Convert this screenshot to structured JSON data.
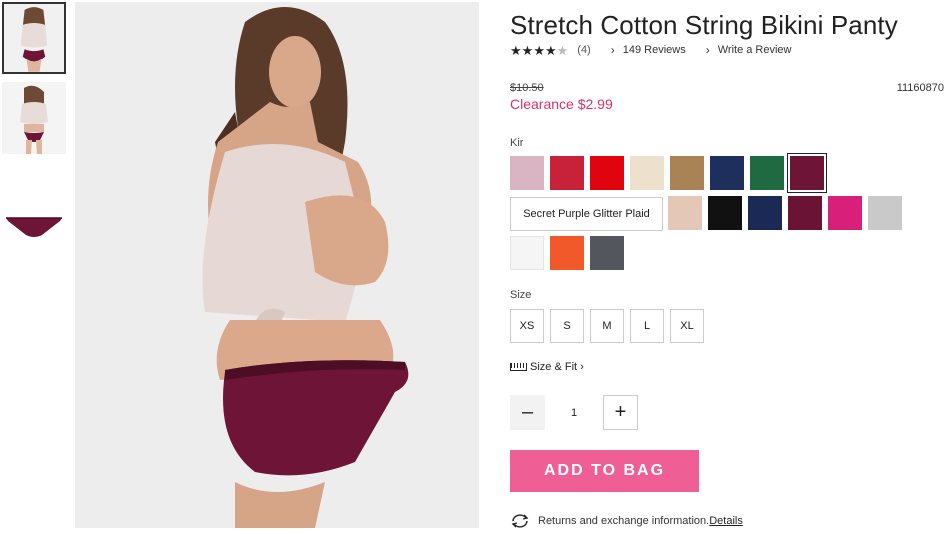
{
  "product": {
    "title": "Stretch Cotton String Bikini Panty",
    "rating_stars": 4,
    "rating_count": "(4)",
    "reviews_link": "149 Reviews",
    "write_review_link": "Write a Review",
    "old_price": "$10.50",
    "clearance_price": "Clearance $2.99",
    "item_number": "11160870"
  },
  "color": {
    "label": "Kir",
    "selected_name": "Secret Purple Glitter Plaid",
    "swatch_colors": [
      "#d9b4c3",
      "#c8213a",
      "#e0040e",
      "#ede0cc",
      "#a98255",
      "#1e2f5e",
      "#1f6a40",
      "#6e1436",
      "#e4c7b7",
      "#111111",
      "#1b2a55",
      "#6b1334",
      "#d81f7a",
      "#c9c9c9",
      "#f5f5f5",
      "#f1592a",
      "#53565c"
    ]
  },
  "size": {
    "label": "Size",
    "options": [
      "XS",
      "S",
      "M",
      "L",
      "XL"
    ]
  },
  "fit": {
    "label": "Size & Fit"
  },
  "quantity": {
    "value": "1",
    "minus": "–",
    "plus": "+"
  },
  "cart": {
    "add_label": "ADD TO BAG"
  },
  "returns": {
    "text": "Returns and exchange information.",
    "details_link": "Details"
  },
  "colors": {
    "brand_pink": "#ef5f96",
    "clearance_red": "#d6336c",
    "panty": "#6e1436"
  }
}
